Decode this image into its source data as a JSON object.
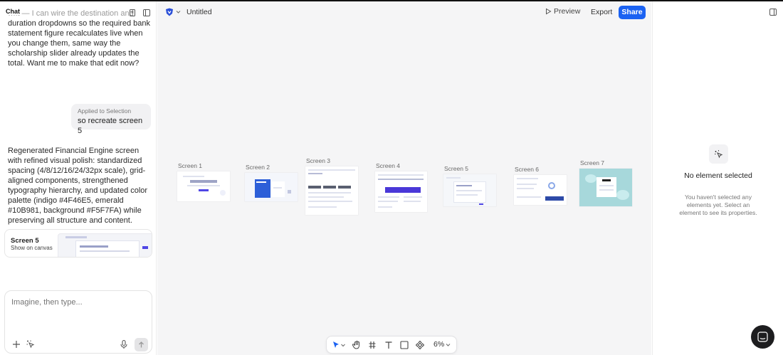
{
  "chat": {
    "title": "Chat",
    "message_1_faded": "…it — I can wire the destination and",
    "message_1": "duration dropdowns so the required bank statement figure recalculates live when you change them, same way the scholarship slider already updates the total. Want me to make that edit now?",
    "user_message": {
      "context": "Applied to Selection",
      "text": "so recreate screen 5"
    },
    "message_2": "Regenerated Financial Engine screen with refined visual polish: standardized spacing (4/8/12/16/24/32px scale), grid-aligned components, strengthened typography hierarchy, and updated color palette (indigo #4F46E5, emerald #10B981, background #F5F7FA) while preserving all structure and content.",
    "card": {
      "title": "Screen 5",
      "action": "Show on canvas"
    },
    "input_placeholder": "Imagine, then type..."
  },
  "topbar": {
    "doc_title": "Untitled",
    "preview_label": "Preview",
    "export_label": "Export",
    "share_label": "Share"
  },
  "screens": [
    {
      "label": "Screen 1"
    },
    {
      "label": "Screen 2"
    },
    {
      "label": "Screen 3"
    },
    {
      "label": "Screen 4"
    },
    {
      "label": "Screen 5"
    },
    {
      "label": "Screen 6"
    },
    {
      "label": "Screen 7"
    }
  ],
  "bottom_toolbar": {
    "zoom": "6%"
  },
  "properties": {
    "empty_title": "No element selected",
    "empty_subtitle": "You haven't selected any elements yet. Select an element to see its properties."
  },
  "colors": {
    "share_blue": "#1b62f2",
    "canvas_bg": "#f5f5f6",
    "indigo": "#4f46e5"
  }
}
